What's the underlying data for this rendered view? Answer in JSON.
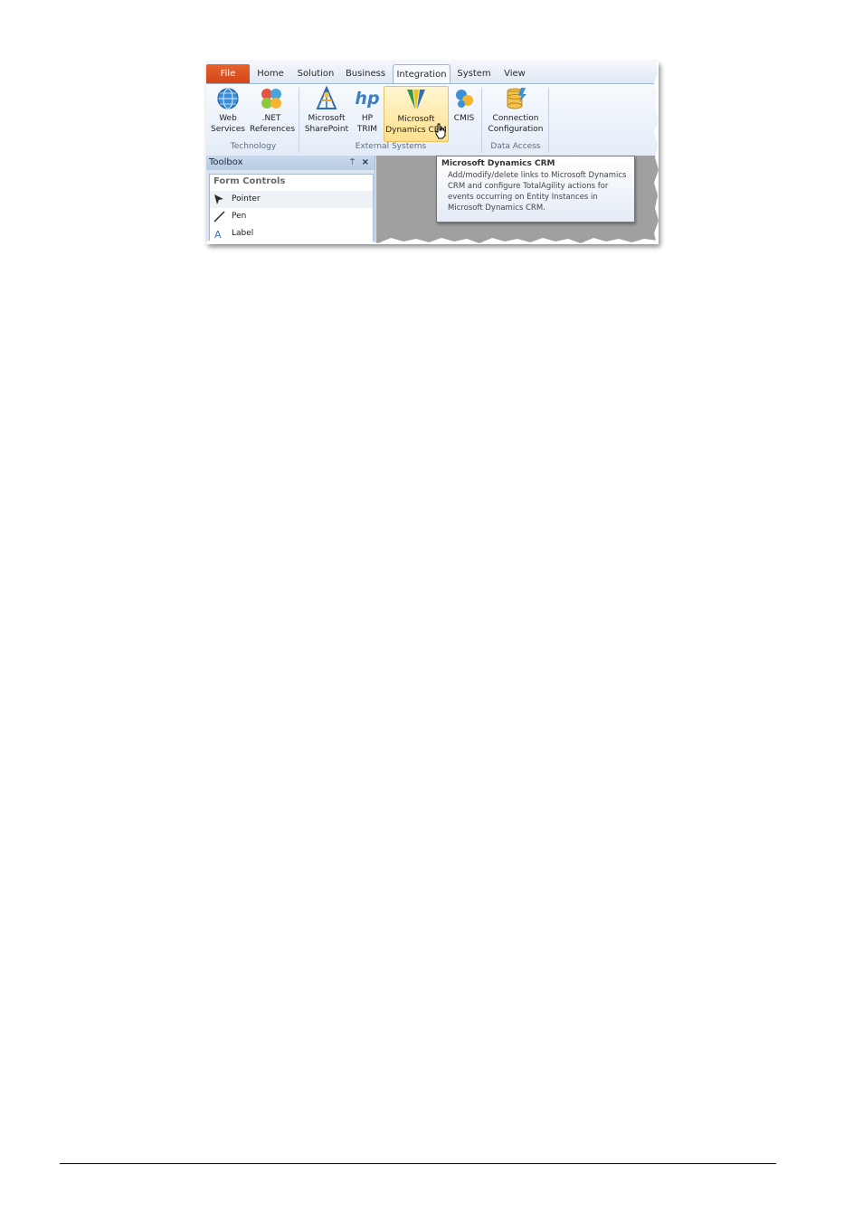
{
  "tabs": {
    "file": "File",
    "home": "Home",
    "solution": "Solution",
    "business": "Business",
    "integration": "Integration",
    "system": "System",
    "view": "View"
  },
  "ribbon": {
    "technology": {
      "label": "Technology",
      "web_services": [
        "Web",
        "Services"
      ],
      "net_references": [
        ".NET",
        "References"
      ]
    },
    "external_systems": {
      "label": "External Systems",
      "sharepoint": [
        "Microsoft",
        "SharePoint"
      ],
      "hp_trim": [
        "HP",
        "TRIM"
      ],
      "dynamics_crm": [
        "Microsoft",
        "Dynamics CRM"
      ],
      "cmis": "CMIS"
    },
    "data_access": {
      "label": "Data Access",
      "connection_configuration": [
        "Connection",
        "Configuration"
      ]
    },
    "hp_logo_text": "hp"
  },
  "toolbox": {
    "title": "Toolbox",
    "pin_glyph": "⍑",
    "close_glyph": "×",
    "section": "Form Controls",
    "items": [
      "Pointer",
      "Pen",
      "Label"
    ]
  },
  "tooltip": {
    "title": "Microsoft Dynamics CRM",
    "body": "Add/modify/delete links to Microsoft Dynamics CRM and configure TotalAgility actions for events occurring on Entity Instances in Microsoft Dynamics CRM."
  },
  "colors": {
    "file_tab": "#d3461b",
    "ribbon_bg": "#e3ecf7",
    "hover_button": "#ffe08e",
    "canvas": "#a0a0a0"
  }
}
